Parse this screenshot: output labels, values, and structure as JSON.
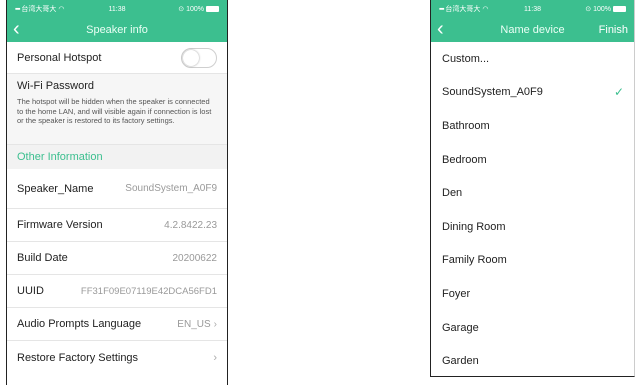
{
  "colors": {
    "accent": "#3cbf8f"
  },
  "left": {
    "status": {
      "carrier": "台湾大哥大",
      "time": "11:38",
      "battery": "100%"
    },
    "nav": {
      "title": "Speaker info"
    },
    "hotspot_label": "Personal Hotspot",
    "hotspot_on": false,
    "wifi": {
      "title": "Wi-Fi Password",
      "description": "The hotspot will be hidden when the speaker is connected to the home LAN, and will visible again if connection is lost or the speaker is restored to its factory settings."
    },
    "section_other": "Other Information",
    "rows": {
      "speaker_name": {
        "label": "Speaker_Name",
        "value": "SoundSystem_A0F9"
      },
      "firmware": {
        "label": "Firmware Version",
        "value": "4.2.8422.23"
      },
      "build_date": {
        "label": "Build Date",
        "value": "20200622"
      },
      "uuid": {
        "label": "UUID",
        "value": "FF31F09E07119E42DCA56FD1"
      },
      "language": {
        "label": "Audio Prompts Language",
        "value": "EN_US"
      },
      "restore": {
        "label": "Restore Factory Settings"
      }
    }
  },
  "right": {
    "status": {
      "carrier": "台湾大哥大",
      "time": "11:38",
      "battery": "100%"
    },
    "nav": {
      "title": "Name device",
      "finish": "Finish"
    },
    "items": [
      "Custom...",
      "SoundSystem_A0F9",
      "Bathroom",
      "Bedroom",
      "Den",
      "Dining Room",
      "Family Room",
      "Foyer",
      "Garage",
      "Garden"
    ],
    "selected_index": 1
  },
  "icons": {
    "back": "chevron-left-icon",
    "check": "checkmark-icon",
    "chevron": "chevron-right-icon"
  }
}
